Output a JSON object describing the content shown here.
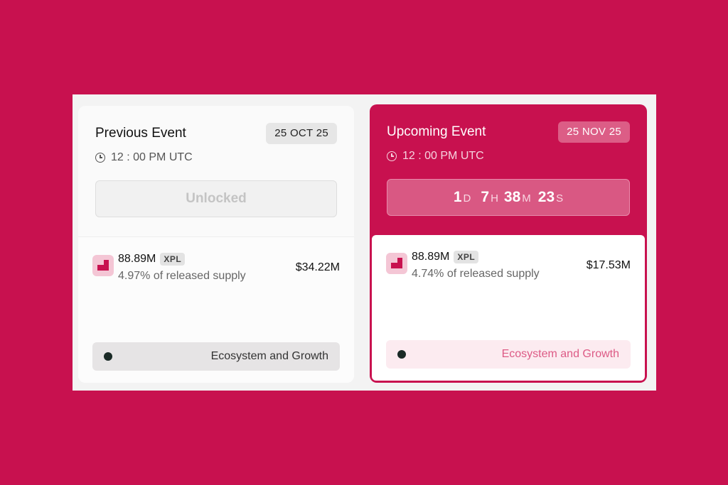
{
  "previous": {
    "title": "Previous Event",
    "date": "25 OCT 25",
    "time": "12 : 00 PM UTC",
    "status": "Unlocked",
    "amount": "88.89M",
    "symbol": "XPL",
    "supply": "4.97% of released supply",
    "usd": "$34.22M",
    "category": "Ecosystem and Growth"
  },
  "upcoming": {
    "title": "Upcoming Event",
    "date": "25 NOV 25",
    "time": "12 : 00 PM UTC",
    "countdown": {
      "days": "1",
      "days_label": "D",
      "hours": "7",
      "hours_label": "H",
      "minutes": "38",
      "minutes_label": "M",
      "seconds": "23",
      "seconds_label": "S"
    },
    "amount": "88.89M",
    "symbol": "XPL",
    "supply": "4.74% of released supply",
    "usd": "$17.53M",
    "category": "Ecosystem and Growth"
  },
  "colors": {
    "brand": "#c8114f",
    "category_dot": "#1a2a26"
  },
  "icons": {
    "clock": "clock-icon",
    "token": "xpl-token-icon"
  }
}
